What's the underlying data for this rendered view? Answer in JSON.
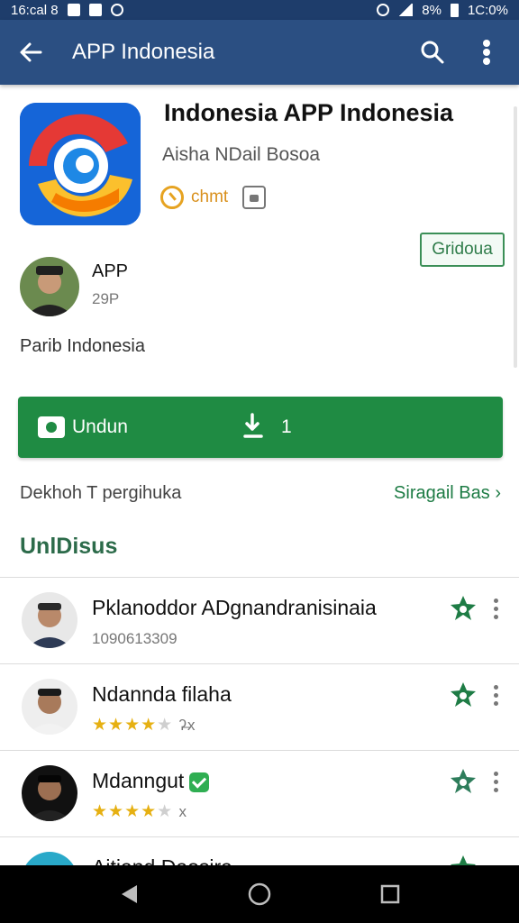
{
  "status_bar": {
    "time": "16:cal 8",
    "battery": "8%",
    "clock": "1C:0%"
  },
  "app_bar": {
    "title": "APP Indonesia"
  },
  "app": {
    "name": "Indonesia APP Indonesia",
    "developer": "Aisha NDail Bosoa",
    "meta_label": "chmt",
    "install_label": "Gridoua"
  },
  "author": {
    "name": "APP",
    "sub": "29P"
  },
  "description": "Parib Indonesia",
  "download": {
    "label": "Undun",
    "count": "1"
  },
  "info": {
    "left": "Dekhoh T pergihuka",
    "link": "Siragail Bas"
  },
  "section_title": "UnlDisus",
  "reviewers": [
    {
      "name": "Pklanoddor ADgnandranisinaia",
      "sub": "1090613309",
      "rating": 0,
      "tail": ""
    },
    {
      "name": "Ndannda filaha",
      "sub": "",
      "rating": 4,
      "tail": "ʔ̶x"
    },
    {
      "name": "Mdanngut",
      "sub": "",
      "rating": 4,
      "tail": "x"
    },
    {
      "name": "Aitiand Daosira",
      "sub": "",
      "rating": 0,
      "tail": ""
    }
  ],
  "colors": {
    "app_bar": "#2b4f82",
    "status_bar": "#1e3d6b",
    "primary_green": "#1f8b43",
    "star": "#e6b012"
  },
  "icons": {
    "back": "arrow-left-icon",
    "search": "search-icon",
    "more": "more-vert-icon",
    "favorite": "star-icon",
    "nav_back": "triangle-back-icon",
    "nav_home": "circle-home-icon",
    "nav_recent": "square-recent-icon"
  }
}
